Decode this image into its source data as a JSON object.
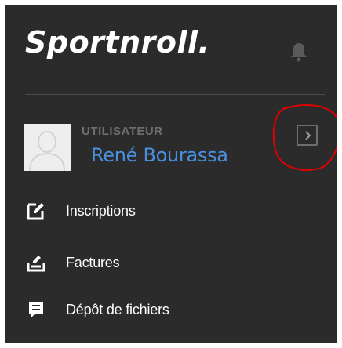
{
  "brand": {
    "logo_text": "Sportnroll."
  },
  "header": {
    "notifications_icon": "bell-icon"
  },
  "user": {
    "role": "UTILISATEUR",
    "name": "René Bourassa",
    "avatar_icon": "user-silhouette-icon",
    "expand_icon": "chevron-right-icon"
  },
  "menu": {
    "items": [
      {
        "label": "Inscriptions",
        "icon": "edit-square-icon"
      },
      {
        "label": "Factures",
        "icon": "invoice-pen-icon"
      },
      {
        "label": "Dépôt de fichiers",
        "icon": "message-file-icon"
      }
    ]
  },
  "colors": {
    "sidebar_background": "#2b2b2b",
    "user_name": "#4a90e2",
    "role_text": "#6e6e6e",
    "annotation_circle": "#e00000"
  }
}
